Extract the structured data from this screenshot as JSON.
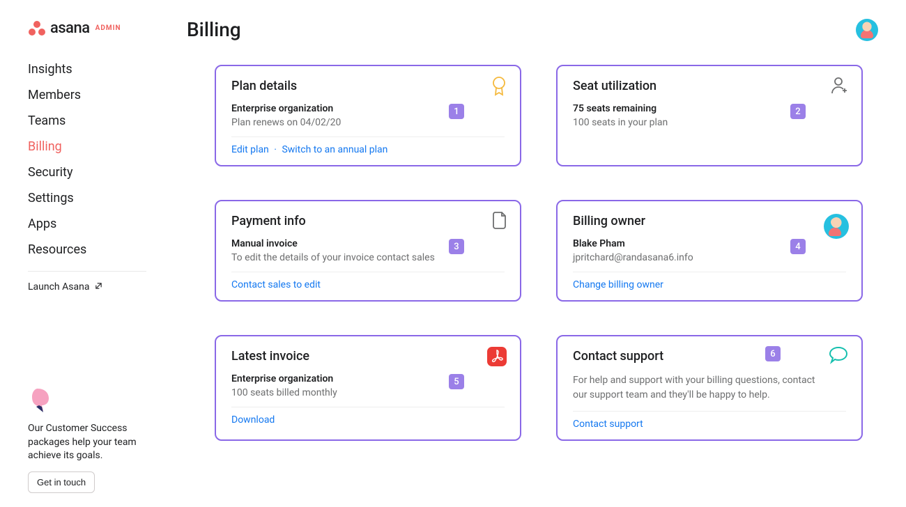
{
  "brand": {
    "name": "asana",
    "sub": "ADMIN"
  },
  "nav": {
    "items": [
      {
        "label": "Insights"
      },
      {
        "label": "Members"
      },
      {
        "label": "Teams"
      },
      {
        "label": "Billing"
      },
      {
        "label": "Security"
      },
      {
        "label": "Settings"
      },
      {
        "label": "Apps"
      },
      {
        "label": "Resources"
      }
    ],
    "launch_label": "Launch Asana"
  },
  "footer_promo": {
    "text": "Our Customer Success packages help your team achieve its goals.",
    "cta": "Get in touch"
  },
  "page": {
    "title": "Billing"
  },
  "cards": {
    "plan_details": {
      "badge": "1",
      "title": "Plan details",
      "plan": "Enterprise organization",
      "renew": "Plan renews on 04/02/20",
      "edit_link": "Edit plan",
      "switch_link": "Switch to an annual plan"
    },
    "seat_util": {
      "badge": "2",
      "title": "Seat utilization",
      "remaining": "75 seats remaining",
      "total": "100 seats in your plan"
    },
    "payment": {
      "badge": "3",
      "title": "Payment info",
      "line1": "Manual invoice",
      "line2": "To edit the details of your invoice contact sales",
      "link": "Contact sales to edit"
    },
    "owner": {
      "badge": "4",
      "title": "Billing owner",
      "name": "Blake Pham",
      "email": "jpritchard@randasana6.info",
      "link": "Change billing owner"
    },
    "invoice": {
      "badge": "5",
      "title": "Latest invoice",
      "line1": "Enterprise organization",
      "line2": "100 seats billed monthly",
      "link": "Download"
    },
    "support": {
      "badge": "6",
      "title": "Contact support",
      "body": "For help and support with your billing questions, contact our support team and they'll be happy to help.",
      "link": "Contact support"
    }
  }
}
